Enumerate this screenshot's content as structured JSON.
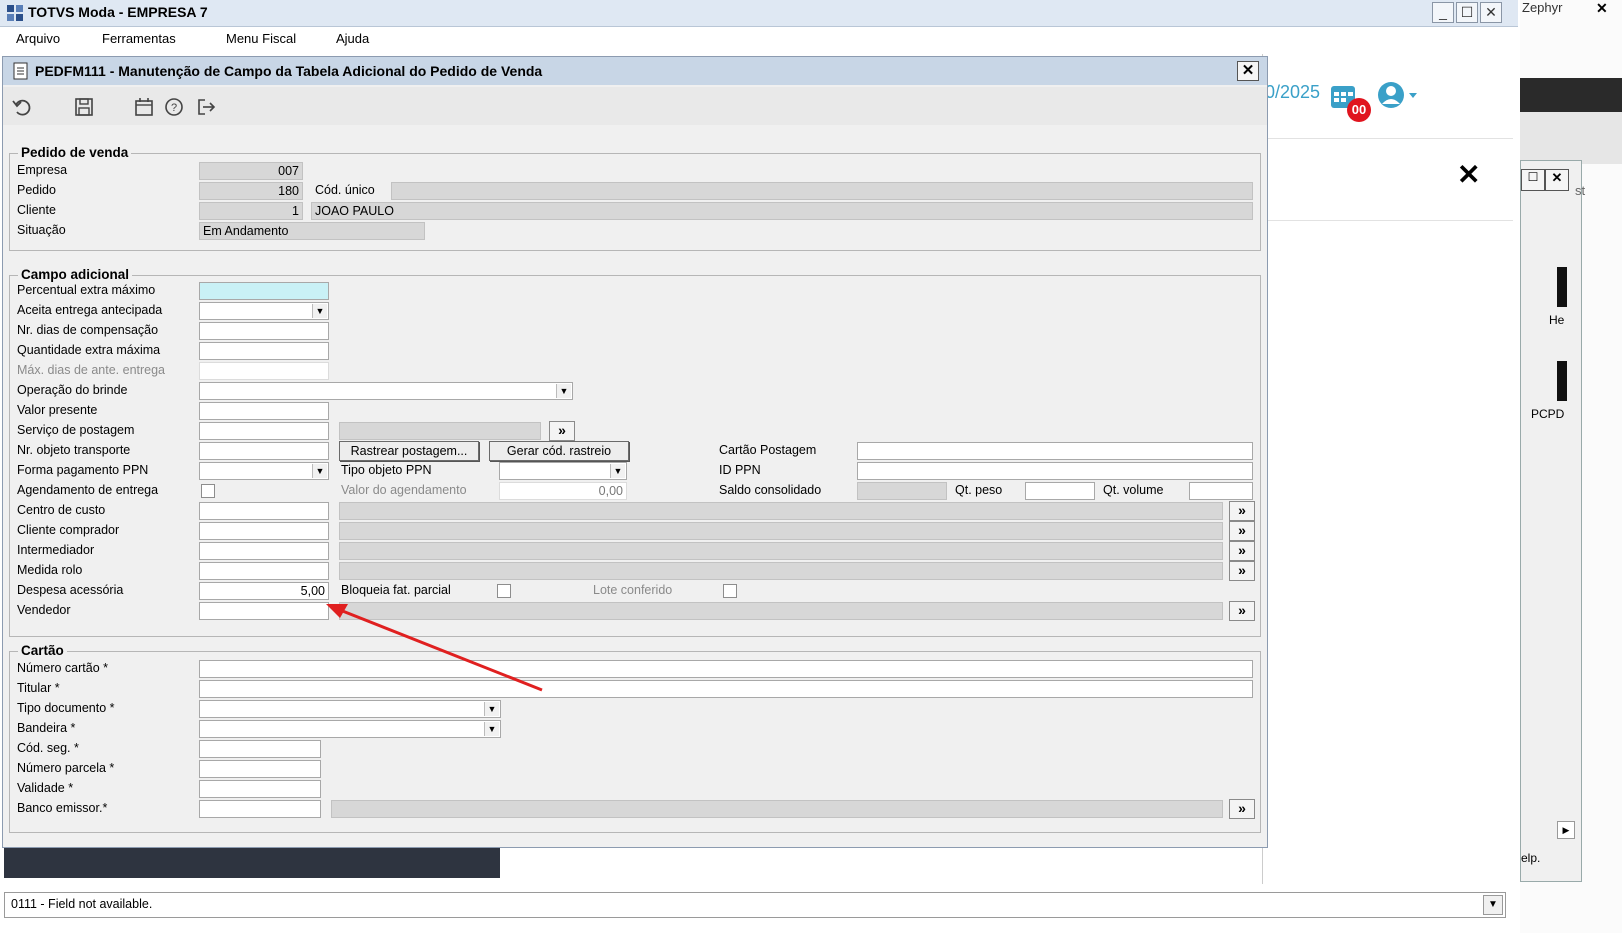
{
  "app": {
    "title": "TOTVS Moda - EMPRESA 7",
    "menu": [
      "Arquivo",
      "Ferramentas",
      "Menu Fiscal",
      "Ajuda"
    ]
  },
  "background": {
    "date_fragment": "0/2025",
    "calendar_badge": "00",
    "zephyr_text": "Zephyr",
    "side_text_1": "He",
    "side_text_2": "PCPD",
    "side_text_3": "elp.",
    "side_text_4": "st"
  },
  "dialog": {
    "title": "PEDFM111 - Manutenção de Campo da Tabela Adicional do Pedido de Venda",
    "toolbar_icons": [
      "undo-icon",
      "save-icon",
      "calendar-icon",
      "help-icon",
      "exit-icon"
    ]
  },
  "pedido": {
    "group": "Pedido de venda",
    "empresa_label": "Empresa",
    "empresa": "007",
    "pedido_label": "Pedido",
    "pedido": "180",
    "cod_unico_label": "Cód. único",
    "cliente_label": "Cliente",
    "cliente_codigo": "1",
    "cliente_nome": "JOAO PAULO",
    "situacao_label": "Situação",
    "situacao": "Em Andamento"
  },
  "campo": {
    "group": "Campo adicional",
    "percentual_extra": "Percentual extra máximo",
    "aceita_entrega": "Aceita entrega antecipada",
    "nr_dias_comp": "Nr. dias de compensação",
    "quantidade_extra": "Quantidade extra máxima",
    "max_dias_ante": "Máx. dias de ante. entrega",
    "operacao_brinde": "Operação do brinde",
    "valor_presente": "Valor presente",
    "servico_postagem": "Serviço de postagem",
    "nr_objeto": "Nr. objeto transporte",
    "rastrear_btn": "Rastrear postagem...",
    "gerar_btn": "Gerar cód. rastreio",
    "cartao_postagem": "Cartão Postagem",
    "forma_pagamento": "Forma pagamento PPN",
    "tipo_objeto": "Tipo objeto PPN",
    "id_ppn": "ID PPN",
    "agendamento": "Agendamento de entrega",
    "valor_agendamento": "Valor do agendamento",
    "valor_agendamento_val": "0,00",
    "saldo_consolidado": "Saldo consolidado",
    "qt_peso": "Qt. peso",
    "qt_volume": "Qt. volume",
    "centro_custo": "Centro de custo",
    "cliente_comprador": "Cliente comprador",
    "intermediador": "Intermediador",
    "medida_rolo": "Medida rolo",
    "despesa_acessoria": "Despesa acessória",
    "despesa_val": "5,00",
    "bloqueia_fat": "Bloqueia fat. parcial",
    "lote_conferido": "Lote conferido",
    "vendedor": "Vendedor",
    "lookup_glyph": "»"
  },
  "cartao": {
    "group": "Cartão",
    "numero": "Número cartão *",
    "titular": "Titular *",
    "tipo_doc": "Tipo documento *",
    "bandeira": "Bandeira *",
    "cod_seg": "Cód. seg. *",
    "numero_parcela": "Número parcela *",
    "validade": "Validade *",
    "banco": "Banco emissor.*"
  },
  "status": {
    "message": "0111 - Field  not available."
  },
  "colors": {
    "highlight_field": "#c9f1f6",
    "annotation_arrow": "#e02020",
    "badge": "#e0141e",
    "accent": "#3aa0c8"
  }
}
